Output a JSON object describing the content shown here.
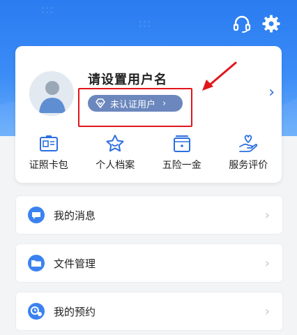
{
  "colors": {
    "hero_top": "#2a7cf0",
    "hero_bottom": "#6aaefb",
    "accent_blue": "#2b6ee0",
    "badge_bg": "#6b87bd",
    "highlight_red": "#e0161b"
  },
  "header": {
    "support_icon": "headset-icon",
    "settings_icon": "gear-icon"
  },
  "profile": {
    "username": "请设置用户名",
    "badge_label": "未认证用户",
    "badge_chevron": "›",
    "card_chevron": "›"
  },
  "quick_actions": [
    {
      "label": "证照卡包",
      "icon": "id-card-icon"
    },
    {
      "label": "个人档案",
      "icon": "star-profile-icon"
    },
    {
      "label": "五险一金",
      "icon": "wallet-icon"
    },
    {
      "label": "服务评价",
      "icon": "hand-heart-icon"
    }
  ],
  "menu": [
    {
      "label": "我的消息",
      "icon": "message-icon",
      "chevron": "›"
    },
    {
      "label": "文件管理",
      "icon": "folder-icon",
      "chevron": "›"
    },
    {
      "label": "我的预约",
      "icon": "appointment-icon",
      "chevron": "›"
    }
  ]
}
